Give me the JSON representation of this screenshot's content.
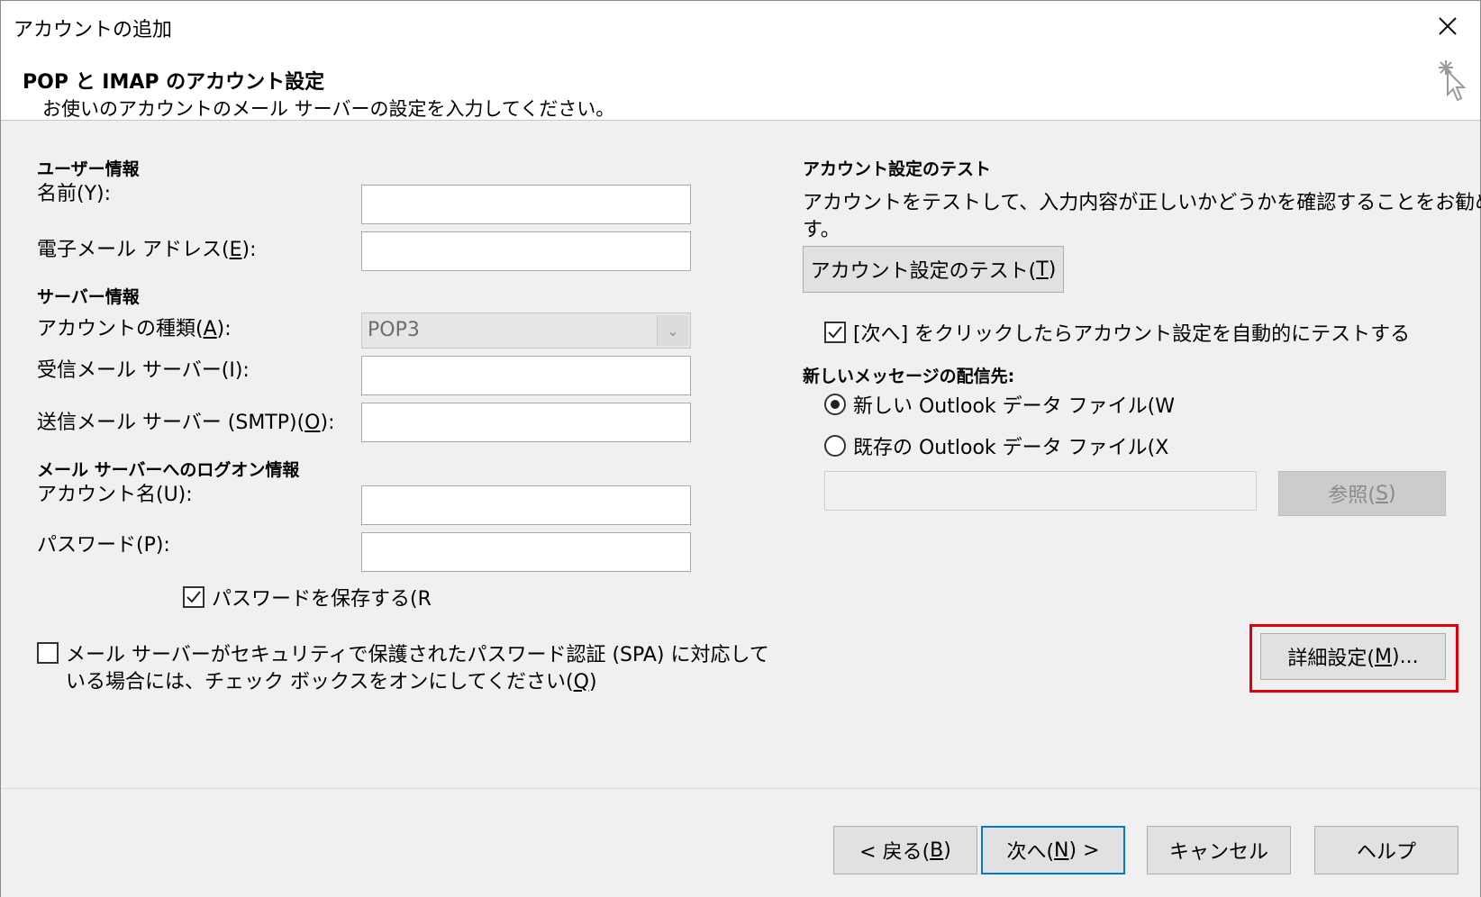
{
  "window": {
    "title": "アカウントの追加"
  },
  "header": {
    "title": "POP と IMAP のアカウント設定",
    "subtitle": "お使いのアカウントのメール サーバーの設定を入力してください。"
  },
  "user_info": {
    "heading": "ユーザー情報",
    "name_label": "名前(Y):",
    "email_label_pre": "電子メール アドレス(",
    "email_label_key": "E",
    "email_label_post": "):",
    "name_value": "",
    "email_value": ""
  },
  "server_info": {
    "heading": "サーバー情報",
    "account_type_label_pre": "アカウントの種類(",
    "account_type_label_key": "A",
    "account_type_label_post": "):",
    "account_type_value": "POP3",
    "incoming_label": "受信メール サーバー(I):",
    "incoming_value": "",
    "outgoing_label_pre": "送信メール サーバー (SMTP)(",
    "outgoing_label_key": "O",
    "outgoing_label_post": "):",
    "outgoing_value": ""
  },
  "logon_info": {
    "heading": "メール サーバーへのログオン情報",
    "account_name_label": "アカウント名(U):",
    "account_name_value": "",
    "password_label": "パスワード(P):",
    "password_value": "",
    "remember_password_label": "パスワードを保存する(R",
    "remember_password_checked": true
  },
  "spa": {
    "label_line1": "メール サーバーがセキュリティで保護されたパスワード認証 (SPA) に対応して",
    "label_line2_pre": "いる場合には、チェック ボックスをオンにしてください(",
    "label_line2_key": "Q",
    "label_line2_post": ")",
    "checked": false
  },
  "test_settings": {
    "heading": "アカウント設定のテスト",
    "desc_line1": "アカウントをテストして、入力内容が正しいかどうかを確認することをお勧めしま",
    "desc_line2": "す。",
    "test_button_pre": "アカウント設定のテスト(",
    "test_button_key": "T",
    "test_button_post": ")",
    "auto_test_label": "[次へ] をクリックしたらアカウント設定を自動的にテストする",
    "auto_test_checked": true
  },
  "delivery": {
    "heading": "新しいメッセージの配信先:",
    "option_new": "新しい Outlook データ ファイル(W",
    "option_existing": "既存の Outlook データ ファイル(X",
    "selected": "new",
    "existing_path_value": "",
    "browse_button_pre": "参照(",
    "browse_button_key": "S",
    "browse_button_post": ")"
  },
  "more_settings": {
    "button_pre": "詳細設定(",
    "button_key": "M",
    "button_post": ")...",
    "highlight_color": "#e0000f"
  },
  "footer": {
    "back_pre": "< 戻る(",
    "back_key": "B",
    "back_post": ")",
    "next_pre": "次へ(",
    "next_key": "N",
    "next_post": ") >",
    "cancel": "キャンセル",
    "help": "ヘルプ"
  },
  "colors": {
    "accent": "#0078d7",
    "dialog_bg": "#f0f0f0",
    "highlight": "#e0000f"
  }
}
